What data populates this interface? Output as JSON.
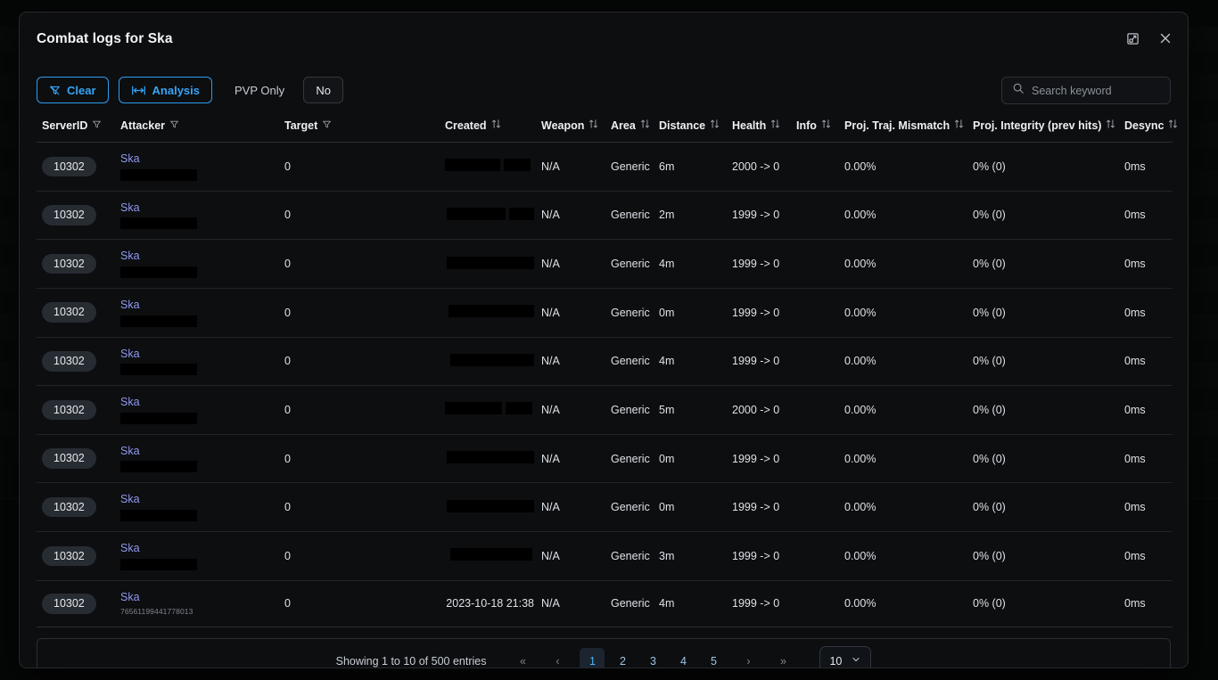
{
  "modal": {
    "title": "Combat logs for Ska",
    "expand_icon": "expand-icon",
    "close_icon": "close-icon"
  },
  "toolbar": {
    "clear_label": "Clear",
    "clear_icon": "filter-off-icon",
    "analysis_label": "Analysis",
    "analysis_icon": "measure-distance-icon",
    "pvp_label": "PVP Only",
    "pvp_value": "No"
  },
  "search": {
    "placeholder": "Search keyword",
    "value": "",
    "icon": "search-icon"
  },
  "table": {
    "columns": [
      {
        "label": "ServerID",
        "control": "filter"
      },
      {
        "label": "Attacker",
        "control": "filter"
      },
      {
        "label": "Target",
        "control": "filter"
      },
      {
        "label": "Created",
        "control": "sort"
      },
      {
        "label": "Weapon",
        "control": "sort"
      },
      {
        "label": "Area",
        "control": "sort"
      },
      {
        "label": "Distance",
        "control": "sort"
      },
      {
        "label": "Health",
        "control": "sort"
      },
      {
        "label": "Info",
        "control": "sort"
      },
      {
        "label": "Proj. Traj. Mismatch",
        "control": "sort"
      },
      {
        "label": "Proj. Integrity (prev hits)",
        "control": "sort"
      },
      {
        "label": "Desync",
        "control": "sort"
      }
    ],
    "rows": [
      {
        "server_id": "10302",
        "attacker": "Ska",
        "attacker_id": "",
        "attacker_redacted": true,
        "target": "0",
        "created": "",
        "created_redacted": true,
        "weapon": "N/A",
        "area": "Generic",
        "distance": "6m",
        "health": "2000 -> 0",
        "info": "",
        "proj_traj_mismatch": "0.00%",
        "proj_integrity": "0% (0)",
        "desync": "0ms"
      },
      {
        "server_id": "10302",
        "attacker": "Ska",
        "attacker_id": "",
        "attacker_redacted": true,
        "target": "0",
        "created": "",
        "created_redacted": true,
        "weapon": "N/A",
        "area": "Generic",
        "distance": "2m",
        "health": "1999 -> 0",
        "info": "",
        "proj_traj_mismatch": "0.00%",
        "proj_integrity": "0% (0)",
        "desync": "0ms"
      },
      {
        "server_id": "10302",
        "attacker": "Ska",
        "attacker_id": "",
        "attacker_redacted": true,
        "target": "0",
        "created": "",
        "created_redacted": true,
        "weapon": "N/A",
        "area": "Generic",
        "distance": "4m",
        "health": "1999 -> 0",
        "info": "",
        "proj_traj_mismatch": "0.00%",
        "proj_integrity": "0% (0)",
        "desync": "0ms"
      },
      {
        "server_id": "10302",
        "attacker": "Ska",
        "attacker_id": "",
        "attacker_redacted": true,
        "target": "0",
        "created": "",
        "created_redacted": true,
        "weapon": "N/A",
        "area": "Generic",
        "distance": "0m",
        "health": "1999 -> 0",
        "info": "",
        "proj_traj_mismatch": "0.00%",
        "proj_integrity": "0% (0)",
        "desync": "0ms"
      },
      {
        "server_id": "10302",
        "attacker": "Ska",
        "attacker_id": "",
        "attacker_redacted": true,
        "target": "0",
        "created": "",
        "created_redacted": true,
        "weapon": "N/A",
        "area": "Generic",
        "distance": "4m",
        "health": "1999 -> 0",
        "info": "",
        "proj_traj_mismatch": "0.00%",
        "proj_integrity": "0% (0)",
        "desync": "0ms"
      },
      {
        "server_id": "10302",
        "attacker": "Ska",
        "attacker_id": "",
        "attacker_redacted": true,
        "target": "0",
        "created": "",
        "created_redacted": true,
        "weapon": "N/A",
        "area": "Generic",
        "distance": "5m",
        "health": "2000 -> 0",
        "info": "",
        "proj_traj_mismatch": "0.00%",
        "proj_integrity": "0% (0)",
        "desync": "0ms"
      },
      {
        "server_id": "10302",
        "attacker": "Ska",
        "attacker_id": "",
        "attacker_redacted": true,
        "target": "0",
        "created": "",
        "created_redacted": true,
        "weapon": "N/A",
        "area": "Generic",
        "distance": "0m",
        "health": "1999 -> 0",
        "info": "",
        "proj_traj_mismatch": "0.00%",
        "proj_integrity": "0% (0)",
        "desync": "0ms"
      },
      {
        "server_id": "10302",
        "attacker": "Ska",
        "attacker_id": "",
        "attacker_redacted": true,
        "target": "0",
        "created": "",
        "created_redacted": true,
        "weapon": "N/A",
        "area": "Generic",
        "distance": "0m",
        "health": "1999 -> 0",
        "info": "",
        "proj_traj_mismatch": "0.00%",
        "proj_integrity": "0% (0)",
        "desync": "0ms"
      },
      {
        "server_id": "10302",
        "attacker": "Ska",
        "attacker_id": "",
        "attacker_redacted": true,
        "target": "0",
        "created": "",
        "created_redacted": true,
        "weapon": "N/A",
        "area": "Generic",
        "distance": "3m",
        "health": "1999 -> 0",
        "info": "",
        "proj_traj_mismatch": "0.00%",
        "proj_integrity": "0% (0)",
        "desync": "0ms"
      },
      {
        "server_id": "10302",
        "attacker": "Ska",
        "attacker_id": "76561199441778013",
        "attacker_redacted": false,
        "target": "0",
        "created": "2023-10-18 21:38",
        "created_redacted": false,
        "weapon": "N/A",
        "area": "Generic",
        "distance": "4m",
        "health": "1999 -> 0",
        "info": "",
        "proj_traj_mismatch": "0.00%",
        "proj_integrity": "0% (0)",
        "desync": "0ms"
      }
    ]
  },
  "pagination": {
    "showing_text": "Showing 1 to 10 of 500 entries",
    "first_label": "«",
    "prev_label": "‹",
    "next_label": "›",
    "last_label": "»",
    "pages": [
      "1",
      "2",
      "3",
      "4",
      "5"
    ],
    "active_page": "1",
    "page_size": "10"
  },
  "colors": {
    "accent": "#2d9cf0",
    "link": "#8f9af0",
    "modal_bg": "#0d0e10",
    "page_bg": "#08090a"
  }
}
